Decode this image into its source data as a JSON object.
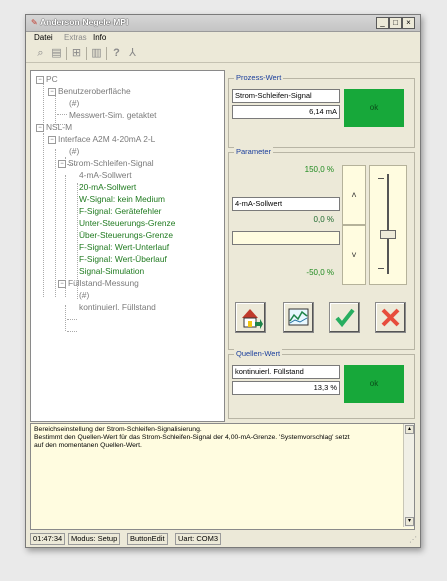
{
  "window": {
    "title": "Anderson-Negele-MPI",
    "menu": [
      "Datei",
      "Extras",
      "Info"
    ]
  },
  "toolbar": {
    "icons": [
      "magnify-icon",
      "save-icon",
      "connect-icon",
      "device-icon",
      "help-icon",
      "tool-icon"
    ]
  },
  "tree": {
    "rows": [
      {
        "label": "PC",
        "green": false
      },
      {
        "label": "Benutzeroberfläche",
        "green": false
      },
      {
        "label": "(#)",
        "green": false
      },
      {
        "label": "Messwert-Sim. getaktet",
        "green": false
      },
      {
        "label": "NSL-M",
        "green": false
      },
      {
        "label": "Interface A2M 4-20mA 2-L",
        "green": false
      },
      {
        "label": "(#)",
        "green": false
      },
      {
        "label": "Strom-Schleifen-Signal",
        "green": false
      },
      {
        "label": "4-mA-Sollwert",
        "green": false
      },
      {
        "label": "20-mA-Sollwert",
        "green": true
      },
      {
        "label": "W-Signal: kein Medium",
        "green": true
      },
      {
        "label": "F-Signal: Gerätefehler",
        "green": true
      },
      {
        "label": "Unter-Steuerungs-Grenze",
        "green": true
      },
      {
        "label": "Über-Steuerungs-Grenze",
        "green": true
      },
      {
        "label": "F-Signal: Wert-Unterlauf",
        "green": true
      },
      {
        "label": "F-Signal: Wert-Überlauf",
        "green": true
      },
      {
        "label": "Signal-Simulation",
        "green": true
      },
      {
        "label": "Füllstand-Messung",
        "green": false
      },
      {
        "label": "(#)",
        "green": false
      },
      {
        "label": "kontinuierl. Füllstand",
        "green": false
      }
    ]
  },
  "prozess": {
    "label": "Prozess-Wert",
    "name": "Strom-Schleifen-Signal",
    "value": "6,14 mA",
    "ok": "ok"
  },
  "parameter": {
    "label": "Parameter",
    "max_pct": "150,0 %",
    "name": "4-mA-Sollwert",
    "value_pct": "0,0 %",
    "input_value": "",
    "min_pct": "-50,0 %",
    "up": "˄",
    "down": "˅",
    "slider_level": 0.4
  },
  "quellen": {
    "label": "Quellen-Wert",
    "name": "kontinuierl. Füllstand",
    "value": "13,3 %",
    "ok": "ok"
  },
  "description": {
    "line1": "Bereichseinstellung der Strom-Schleifen-Signalisierung.",
    "line2": "Bestimmt den Quellen-Wert für das Strom-Schleifen-Signal der 4,00-mA-Grenze. 'Systemvorschlag' setzt",
    "line3": "auf den momentanen Quellen-Wert."
  },
  "status": {
    "time": "01:47:34",
    "mode": "Modus: Setup",
    "edit": "ButtonEdit",
    "port": "Uart: COM3"
  },
  "colors": {
    "ok_green": "#17a83a",
    "tree_green": "#1f7a1f",
    "panel": "#ece9d8"
  }
}
